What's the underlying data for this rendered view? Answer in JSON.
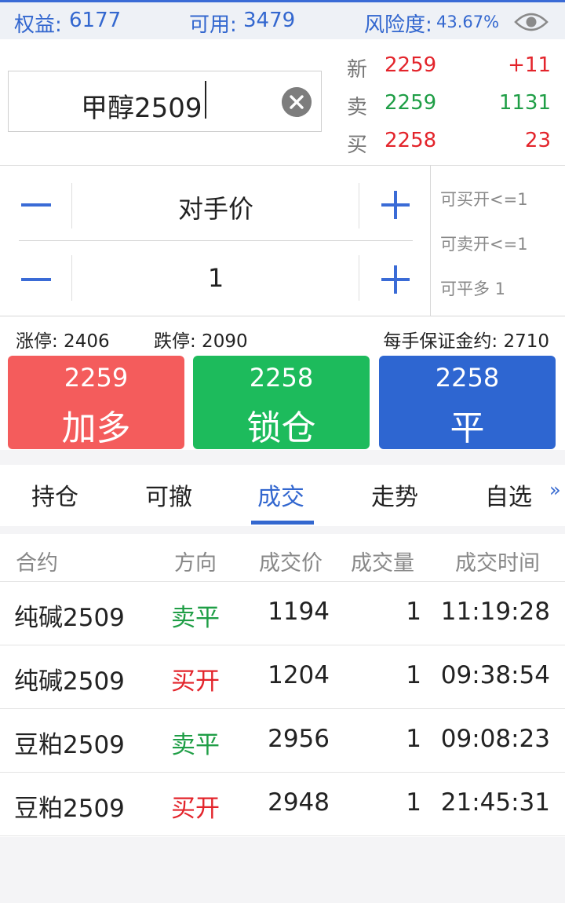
{
  "account": {
    "equity_label": "权益:",
    "equity_value": "6177",
    "available_label": "可用:",
    "available_value": "3479",
    "risk_label": "风险度:",
    "risk_value": "43.67%"
  },
  "contract": {
    "search_value": "甲醇2509"
  },
  "quote": {
    "rows": [
      {
        "label": "新",
        "price": "2259",
        "extra": "+11"
      },
      {
        "label": "卖",
        "price": "2259",
        "extra": "1131"
      },
      {
        "label": "买",
        "price": "2258",
        "extra": "23"
      }
    ]
  },
  "order": {
    "price_mode": "对手价",
    "quantity": "1",
    "can_buy_open": "可买开<=1",
    "can_sell_open": "可卖开<=1",
    "can_close_long": "可平多 1"
  },
  "limits": {
    "limit_up": "涨停: 2406",
    "limit_down": "跌停: 2090",
    "margin": "每手保证金约: 2710"
  },
  "actions": [
    {
      "price": "2259",
      "label": "加多",
      "color": "#f45c5c"
    },
    {
      "price": "2258",
      "label": "锁仓",
      "color": "#1dbb5c"
    },
    {
      "price": "2258",
      "label": "平",
      "color": "#2e66d1"
    }
  ],
  "tabs": {
    "items": [
      "持仓",
      "可撤",
      "成交",
      "走势",
      "自选"
    ],
    "active": "成交",
    "more": "»"
  },
  "trades": {
    "headers": [
      "合约",
      "方向",
      "成交价",
      "成交量",
      "成交时间"
    ],
    "rows": [
      {
        "contract": "纯碱2509",
        "direction": "卖平",
        "price": "1194",
        "volume": "1",
        "time": "11:19:28"
      },
      {
        "contract": "纯碱2509",
        "direction": "买开",
        "price": "1204",
        "volume": "1",
        "time": "09:38:54"
      },
      {
        "contract": "豆粕2509",
        "direction": "卖平",
        "price": "2956",
        "volume": "1",
        "time": "09:08:23"
      },
      {
        "contract": "豆粕2509",
        "direction": "买开",
        "price": "2948",
        "volume": "1",
        "time": "21:45:31"
      }
    ]
  },
  "colors": {
    "accent": "#3367cf",
    "up": "#e3242b",
    "down": "#1f9e46"
  },
  "icons": {
    "visibility": "eye-icon",
    "clear": "clear-circle-icon",
    "decrease": "minus-icon",
    "increase": "plus-icon"
  }
}
